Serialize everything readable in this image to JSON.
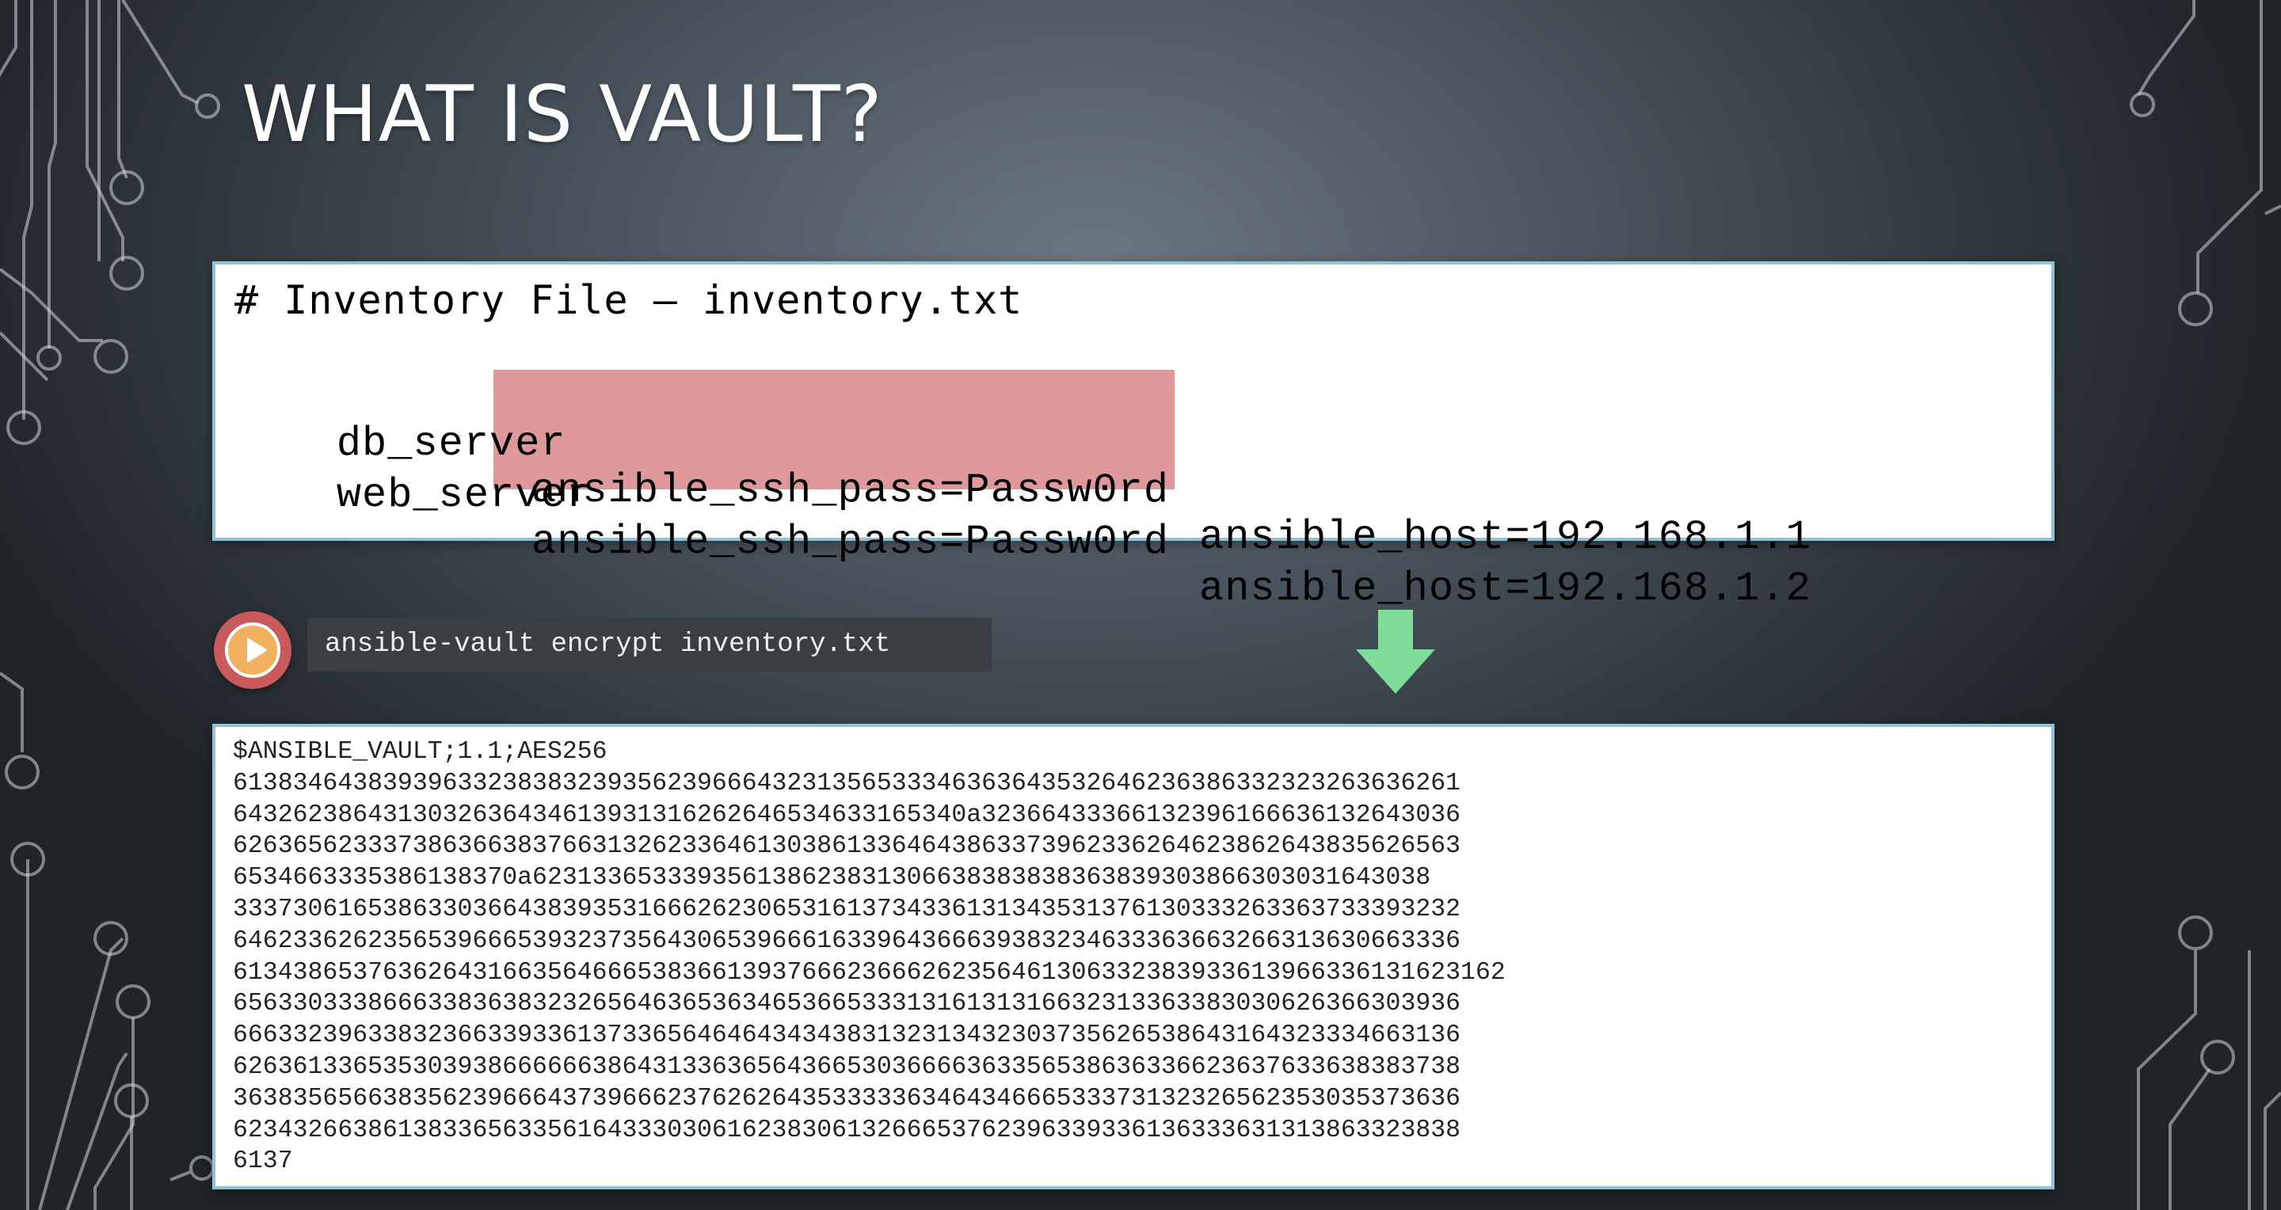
{
  "slide": {
    "title": "WHAT IS VAULT?"
  },
  "inventory": {
    "header": "# Inventory File – inventory.txt",
    "rows": [
      {
        "host": "db_server",
        "pass": "ansible_ssh_pass=Passw0rd",
        "rest": "ansible_host=192.168.1.1"
      },
      {
        "host": "web_server",
        "pass": "ansible_ssh_pass=Passw0rd",
        "rest": "ansible_host=192.168.1.2"
      }
    ]
  },
  "command": {
    "text": "ansible-vault encrypt inventory.txt",
    "play_icon": "play-circle-icon",
    "arrow_icon": "arrow-down-icon",
    "arrow_color": "#7fdc99"
  },
  "vault_output": {
    "lines": [
      "$ANSIBLE_VAULT;1.1;AES256",
      "6138346438393963323838323935623966643231356533346363643532646236386332323263636261",
      "6432623864313032636434613931316262646534633165340a32366433366132396166636132643036",
      "6263656233373863663837663132623364613038613364643863373962336264623862643835626563",
      "6534663335386138370a623133653339356138623831306638383838363839303866303031643038",
      "3337306165386330366438393531666262306531613734336131343531376130333263363733393232",
      "6462336262356539666539323735643065396661633964366639383234633363663266313630663336",
      "6134386537636264316635646665383661393766623666262356461306332383933613966336131623162",
      "6563303338666338363832326564636536346536653331316131316632313363383030626366303936",
      "6663323963383236633933613733656464643434383132313432303735626538643164323334663136",
      "6263613365353039386666663864313363656436653036666363356538636336623637633638383738",
      "3638356566383562396664373966623762626435333336346434666533373132326562353035373636",
      "6234326638613833656335616433303061623830613266653762396339336136333631313863323838",
      "6137"
    ]
  },
  "theme": {
    "highlight_color": "#e0999b",
    "box_border_color": "#8fc3d8",
    "command_bg": "#393e43",
    "play_button_color": "#c9595b"
  }
}
